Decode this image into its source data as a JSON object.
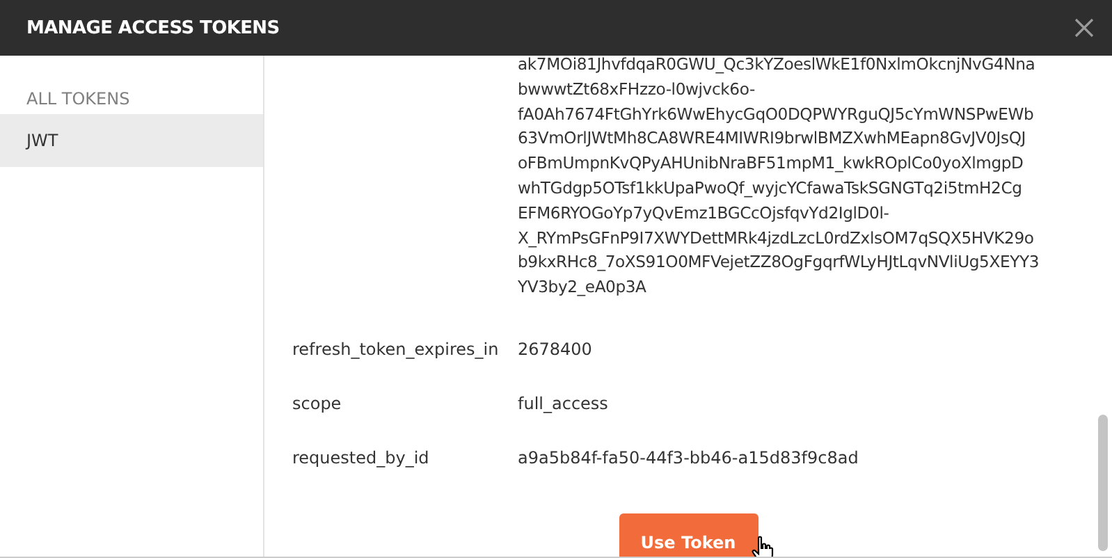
{
  "window": {
    "title": "MANAGE ACCESS TOKENS"
  },
  "sidebar": {
    "heading": "ALL TOKENS",
    "items": [
      {
        "label": "JWT",
        "selected": true
      }
    ]
  },
  "token_value_lines": [
    "ak7MOi81JhvfdqaR0GWU_Qc3kYZoeslWkE1f0NxlmOkcnjNvG4Nna",
    "bwwwtZt68xFHzzo-l0wjvck6o-",
    "fA0Ah7674FtGhYrk6WwEhycGqO0DQPWYRguQJ5cYmWNSPwEWb",
    "63VmOrlJWtMh8CA8WRE4MIWRI9brwlBMZXwhMEapn8GvJV0JsQJ",
    "oFBmUmpnKvQPyAHUnibNraBF51mpM1_kwkROplCo0yoXlmgpD",
    "whTGdgp5OTsf1kkUpaPwoQf_wyjcYCfawaTskSGNGTq2i5tmH2Cg",
    "EFM6RYOGoYp7yQvEmz1BGCcOjsfqvYd2IglD0l-",
    "X_RYmPsGFnP9I7XWYDettMRk4jzdLzcL0rdZxlsOM7qSQX5HVK29o",
    "b9kxRHc8_7oXS91O0MFVejetZZ8OgFgqrfWLyHJtLqvNVliUg5XEYY3",
    "YV3by2_eA0p3A"
  ],
  "fields": [
    {
      "key": "refresh_token_expires_in",
      "value": "2678400"
    },
    {
      "key": "scope",
      "value": "full_access"
    },
    {
      "key": "requested_by_id",
      "value": "a9a5b84f-fa50-44f3-bb46-a15d83f9c8ad"
    }
  ],
  "button": {
    "label": "Use Token"
  }
}
